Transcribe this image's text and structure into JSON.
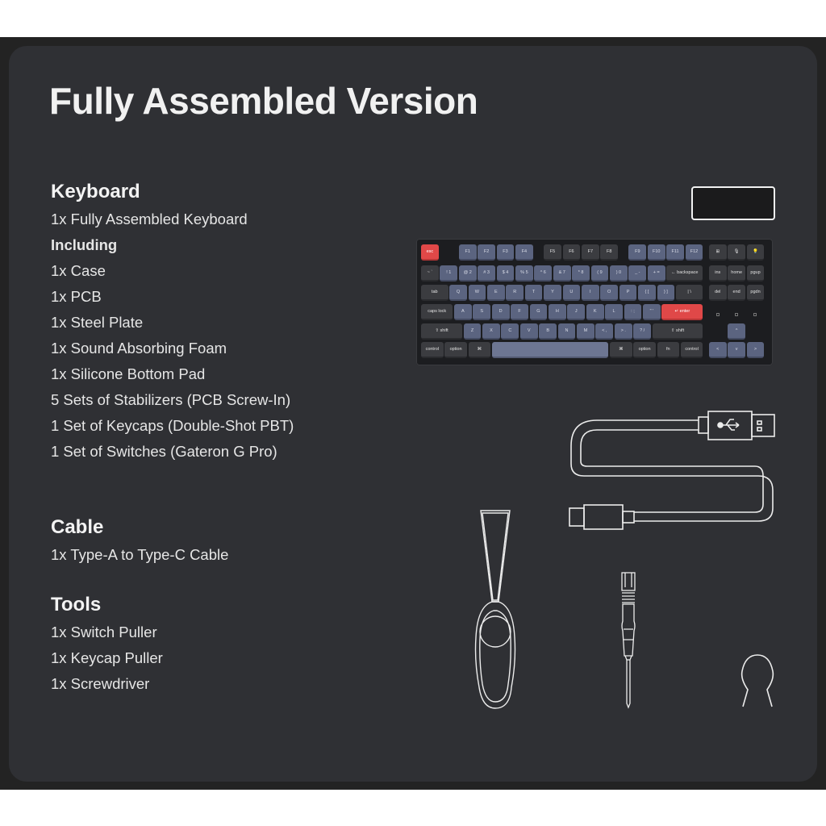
{
  "title": "Fully Assembled Version",
  "sections": {
    "keyboard": {
      "heading": "Keyboard",
      "items": [
        "1x Fully Assembled Keyboard",
        "Including",
        "1x Case",
        "1x PCB",
        "1x Steel Plate",
        "1x Sound Absorbing Foam",
        "1x Silicone Bottom Pad",
        "5 Sets of Stabilizers (PCB Screw-In)",
        "1 Set of Keycaps (Double-Shot PBT)",
        "1 Set of Switches (Gateron G Pro)"
      ]
    },
    "cable": {
      "heading": "Cable",
      "items": [
        "1x Type-A to Type-C Cable"
      ]
    },
    "tools": {
      "heading": "Tools",
      "items": [
        "1x Switch Puller",
        "1x Keycap Puller",
        "1x Screwdriver"
      ]
    }
  },
  "keyboard_illustration": {
    "colors": {
      "accent_red": "#e04848",
      "blue_key": "#5b6480",
      "dark_key": "#3b3c40",
      "spacebar": "#6d7692"
    },
    "rows": [
      [
        {
          "l": "esc",
          "c": "red",
          "w": 1
        },
        {
          "gap": 1
        },
        {
          "l": "F1",
          "c": "blue",
          "w": 1
        },
        {
          "l": "F2",
          "c": "blue",
          "w": 1
        },
        {
          "l": "F3",
          "c": "blue",
          "w": 1
        },
        {
          "l": "F4",
          "c": "blue",
          "w": 1
        },
        {
          "gap": 0.5
        },
        {
          "l": "F5",
          "c": "dark",
          "w": 1
        },
        {
          "l": "F6",
          "c": "dark",
          "w": 1
        },
        {
          "l": "F7",
          "c": "dark",
          "w": 1
        },
        {
          "l": "F8",
          "c": "dark",
          "w": 1
        },
        {
          "gap": 0.5
        },
        {
          "l": "F9",
          "c": "blue",
          "w": 1
        },
        {
          "l": "F10",
          "c": "blue",
          "w": 1
        },
        {
          "l": "F11",
          "c": "blue",
          "w": 1
        },
        {
          "l": "F12",
          "c": "blue",
          "w": 1
        },
        {
          "gap": 0.25
        },
        {
          "l": "⊞",
          "c": "dark",
          "w": 1
        },
        {
          "l": "🎙",
          "c": "dark",
          "w": 1
        },
        {
          "l": "💡",
          "c": "dark",
          "w": 1
        }
      ],
      [
        {
          "l": "~ `",
          "c": "dark",
          "w": 1
        },
        {
          "l": "! 1",
          "c": "blue",
          "w": 1
        },
        {
          "l": "@ 2",
          "c": "blue",
          "w": 1
        },
        {
          "l": "# 3",
          "c": "blue",
          "w": 1
        },
        {
          "l": "$ 4",
          "c": "blue",
          "w": 1
        },
        {
          "l": "% 5",
          "c": "blue",
          "w": 1
        },
        {
          "l": "^ 6",
          "c": "blue",
          "w": 1
        },
        {
          "l": "& 7",
          "c": "blue",
          "w": 1
        },
        {
          "l": "* 8",
          "c": "blue",
          "w": 1
        },
        {
          "l": "( 9",
          "c": "blue",
          "w": 1
        },
        {
          "l": ") 0",
          "c": "blue",
          "w": 1
        },
        {
          "l": "_ -",
          "c": "blue",
          "w": 1
        },
        {
          "l": "+ =",
          "c": "blue",
          "w": 1
        },
        {
          "l": "← backspace",
          "c": "dark",
          "w": 2
        },
        {
          "gap": 0.25
        },
        {
          "l": "ins",
          "c": "dark",
          "w": 1
        },
        {
          "l": "home",
          "c": "dark",
          "w": 1
        },
        {
          "l": "pgup",
          "c": "dark",
          "w": 1
        }
      ],
      [
        {
          "l": "tab",
          "c": "dark",
          "w": 1.5
        },
        {
          "l": "Q",
          "c": "blue",
          "w": 1
        },
        {
          "l": "W",
          "c": "blue",
          "w": 1
        },
        {
          "l": "E",
          "c": "blue",
          "w": 1
        },
        {
          "l": "R",
          "c": "blue",
          "w": 1
        },
        {
          "l": "T",
          "c": "blue",
          "w": 1
        },
        {
          "l": "Y",
          "c": "blue",
          "w": 1
        },
        {
          "l": "U",
          "c": "blue",
          "w": 1
        },
        {
          "l": "I",
          "c": "blue",
          "w": 1
        },
        {
          "l": "O",
          "c": "blue",
          "w": 1
        },
        {
          "l": "P",
          "c": "blue",
          "w": 1
        },
        {
          "l": "{ [",
          "c": "blue",
          "w": 1
        },
        {
          "l": "} ]",
          "c": "blue",
          "w": 1
        },
        {
          "l": "| \\",
          "c": "dark",
          "w": 1.5
        },
        {
          "gap": 0.25
        },
        {
          "l": "del",
          "c": "dark",
          "w": 1
        },
        {
          "l": "end",
          "c": "dark",
          "w": 1
        },
        {
          "l": "pgdn",
          "c": "dark",
          "w": 1
        }
      ],
      [
        {
          "l": "caps lock",
          "c": "dark",
          "w": 1.75
        },
        {
          "l": "A",
          "c": "blue",
          "w": 1
        },
        {
          "l": "S",
          "c": "blue",
          "w": 1
        },
        {
          "l": "D",
          "c": "blue",
          "w": 1
        },
        {
          "l": "F",
          "c": "blue",
          "w": 1
        },
        {
          "l": "G",
          "c": "blue",
          "w": 1
        },
        {
          "l": "H",
          "c": "blue",
          "w": 1
        },
        {
          "l": "J",
          "c": "blue",
          "w": 1
        },
        {
          "l": "K",
          "c": "blue",
          "w": 1
        },
        {
          "l": "L",
          "c": "blue",
          "w": 1
        },
        {
          "l": ": ;",
          "c": "blue",
          "w": 1
        },
        {
          "l": "\" '",
          "c": "blue",
          "w": 1
        },
        {
          "l": "↵ enter",
          "c": "red",
          "w": 2.25
        }
      ],
      [
        {
          "l": "⇧ shift",
          "c": "dark",
          "w": 2.25
        },
        {
          "l": "Z",
          "c": "blue",
          "w": 1
        },
        {
          "l": "X",
          "c": "blue",
          "w": 1
        },
        {
          "l": "C",
          "c": "blue",
          "w": 1
        },
        {
          "l": "V",
          "c": "blue",
          "w": 1
        },
        {
          "l": "B",
          "c": "blue",
          "w": 1
        },
        {
          "l": "N",
          "c": "blue",
          "w": 1
        },
        {
          "l": "M",
          "c": "blue",
          "w": 1
        },
        {
          "l": "< ,",
          "c": "blue",
          "w": 1
        },
        {
          "l": "> .",
          "c": "blue",
          "w": 1
        },
        {
          "l": "? /",
          "c": "blue",
          "w": 1
        },
        {
          "l": "⇧ shift",
          "c": "dark",
          "w": 2.75
        },
        {
          "gap": 1.25
        },
        {
          "l": "^",
          "c": "blue",
          "w": 1
        }
      ],
      [
        {
          "l": "control",
          "c": "dark",
          "w": 1.25
        },
        {
          "l": "option",
          "c": "dark",
          "w": 1.25
        },
        {
          "l": "⌘",
          "c": "dark",
          "w": 1.25
        },
        {
          "l": "",
          "c": "space",
          "w": 6.25
        },
        {
          "l": "⌘",
          "c": "dark",
          "w": 1.25
        },
        {
          "l": "option",
          "c": "dark",
          "w": 1.25
        },
        {
          "l": "fn",
          "c": "dark",
          "w": 1.25
        },
        {
          "l": "control",
          "c": "dark",
          "w": 1.25
        },
        {
          "gap": 0.25
        },
        {
          "l": "<",
          "c": "blue",
          "w": 1
        },
        {
          "l": "v",
          "c": "blue",
          "w": 1
        },
        {
          "l": ">",
          "c": "blue",
          "w": 1
        }
      ]
    ]
  }
}
